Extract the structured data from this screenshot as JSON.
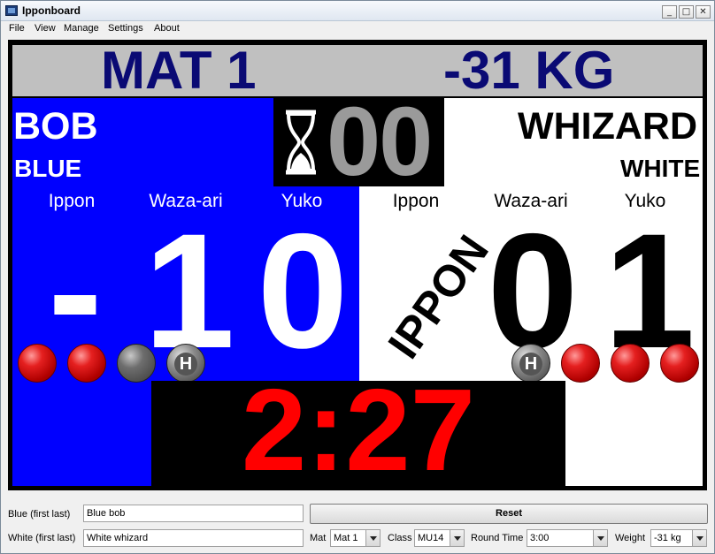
{
  "window": {
    "title": "Ipponboard"
  },
  "menu": [
    "File",
    "View",
    "Manage",
    "Settings",
    "About"
  ],
  "board": {
    "mat": "MAT 1",
    "weight": "-31 KG",
    "osaekomi_time": "00",
    "clock": "2:27",
    "ippon_stamp": "IPPON",
    "blue": {
      "name": "BOB",
      "color": "BLUE",
      "labels": [
        "Ippon",
        "Waza-ari",
        "Yuko"
      ],
      "scores": [
        "-",
        "1",
        "0"
      ],
      "penalties": [
        "red",
        "red",
        "gray",
        "hansoku"
      ],
      "hansoku_letter": "H"
    },
    "white": {
      "name": "WHIZARD",
      "color": "WHITE",
      "labels": [
        "Ippon",
        "Waza-ari",
        "Yuko"
      ],
      "scores": [
        "0",
        "1"
      ],
      "penalties": [
        "hansoku",
        "red",
        "red",
        "red"
      ],
      "hansoku_letter": "H"
    },
    "colors": {
      "blue": "#0000ff",
      "white": "#ffffff",
      "header": "#c0c0c0",
      "header_text": "#0a0a74",
      "clock": "#ff0000"
    }
  },
  "controls": {
    "blue_label": "Blue (first last)",
    "blue_value": "Blue bob",
    "white_label": "White (first last)",
    "white_value": "White whizard",
    "reset": "Reset",
    "mat_label": "Mat",
    "mat_value": "Mat 1",
    "class_label": "Class",
    "class_value": "MU14",
    "round_label": "Round Time",
    "round_value": "3:00",
    "weight_label": "Weight",
    "weight_value": "-31 kg"
  }
}
